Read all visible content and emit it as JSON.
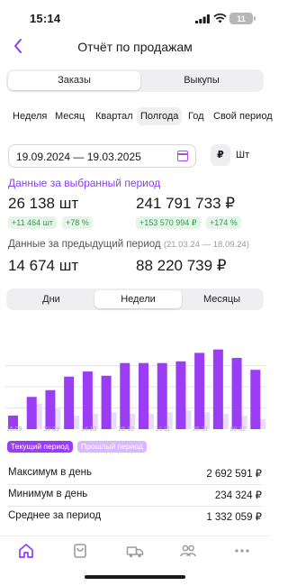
{
  "status": {
    "time": "15:14",
    "battery": "11"
  },
  "header": {
    "title": "Отчёт по продажам"
  },
  "mode_tabs": [
    {
      "label": "Заказы",
      "selected": true
    },
    {
      "label": "Выкупы",
      "selected": false
    }
  ],
  "periods": [
    {
      "label": "Неделя",
      "selected": false
    },
    {
      "label": "Месяц",
      "selected": false
    },
    {
      "label": "Квартал",
      "selected": false
    },
    {
      "label": "Полгода",
      "selected": true
    },
    {
      "label": "Год",
      "selected": false
    },
    {
      "label": "Свой период",
      "selected": false
    }
  ],
  "date_range": "19.09.2024 — 19.03.2025",
  "currency_symbol": "₽",
  "unit_label": "Шт",
  "selected_period": {
    "title": "Данные за выбранный период",
    "qty": "26 138 шт",
    "sum": "241 791 733 ₽",
    "qty_delta": "+11 464 шт",
    "qty_delta_pct": "+78 %",
    "sum_delta": "+153 570 994 ₽",
    "sum_delta_pct": "+174 %"
  },
  "previous_period": {
    "title": "Данные за предыдущий период",
    "range": "(21.03.24 — 18.09.24)",
    "qty": "14 674 шт",
    "sum": "88 220 739 ₽"
  },
  "granularity_tabs": [
    {
      "label": "Дни",
      "selected": false
    },
    {
      "label": "Недели",
      "selected": true
    },
    {
      "label": "Месяцы",
      "selected": false
    }
  ],
  "chart_data": {
    "type": "bar",
    "categories": [
      "16.09",
      "23.09",
      "30.09",
      "07.10",
      "14.10",
      "21.10",
      "28.10",
      "04.11",
      "11.11",
      "18.11",
      "25.11",
      "02.12",
      "09.12",
      "16.12"
    ],
    "tick_labels": [
      "16.09",
      "30.09",
      "14.10",
      "28.10",
      "11.11",
      "25.11",
      "09.12"
    ],
    "series": [
      {
        "name": "Текущий период",
        "color": "#9b3df5",
        "values": [
          16,
          38,
          46,
          62,
          68,
          63,
          78,
          78,
          78,
          80,
          90,
          94,
          84,
          70
        ]
      },
      {
        "name": "Прошлый период",
        "color": "#e7dcfa",
        "values": [
          0,
          30,
          24,
          16,
          18,
          20,
          18,
          18,
          20,
          22,
          20,
          18,
          16,
          12
        ]
      }
    ],
    "ylim": [
      0,
      100
    ],
    "grid": true
  },
  "stats": [
    {
      "label": "Максимум в день",
      "value": "2 692 591 ₽"
    },
    {
      "label": "Минимум в день",
      "value": "234 324 ₽"
    },
    {
      "label": "Среднее за период",
      "value": "1 332 059 ₽"
    }
  ],
  "colors": {
    "accent": "#8b3dff",
    "positive": "#2e9e4a",
    "positive_bg": "#e6f5e9"
  },
  "tabbar": [
    {
      "icon": "home-icon",
      "active": true
    },
    {
      "icon": "bag-icon",
      "active": false
    },
    {
      "icon": "truck-icon",
      "active": false
    },
    {
      "icon": "users-icon",
      "active": false
    },
    {
      "icon": "more-icon",
      "active": false
    }
  ]
}
